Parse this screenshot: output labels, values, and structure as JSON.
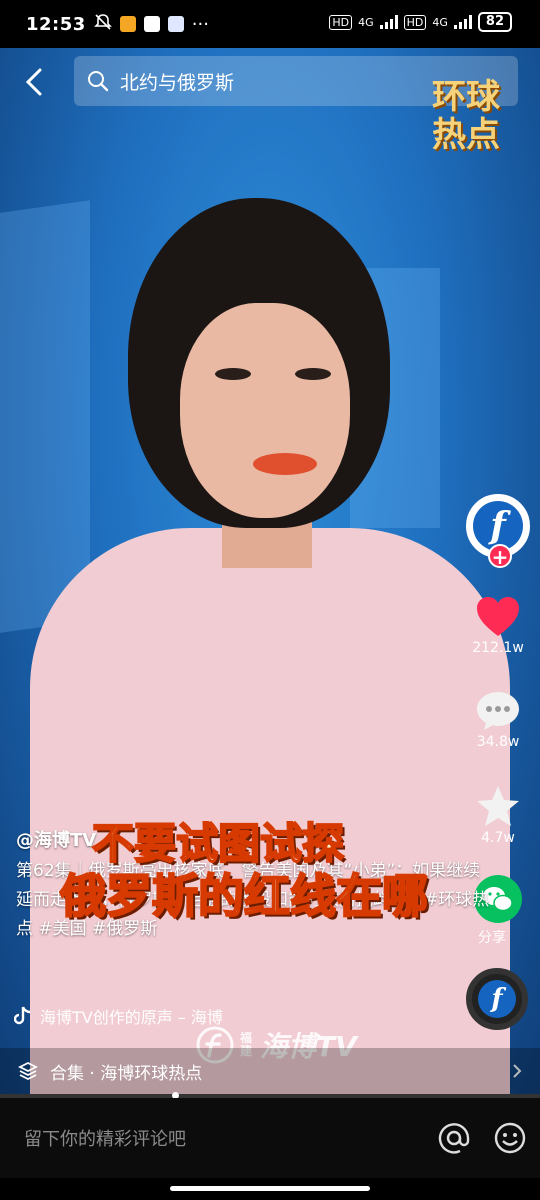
{
  "status_bar": {
    "time": "12:53",
    "network_1": "4G",
    "network_2": "4G",
    "hd": "HD",
    "battery": "82",
    "more": "···"
  },
  "search": {
    "query": "北约与俄罗斯"
  },
  "brand_badge": {
    "line1": "环球",
    "line2": "热点"
  },
  "actions": {
    "likes": "212.1w",
    "comments": "34.8w",
    "favorites": "4.7w",
    "share_label": "分享"
  },
  "post": {
    "author": "@海博TV",
    "caption": "第62集｜俄罗斯亮出核家底，警告美国及其“小弟”：如果继续延而走险时，俄罗斯有足够的手段和能力收拾挑衅者！#环球热点 #美国 #俄罗斯",
    "overlay_line1": "不要试图试探",
    "overlay_line2": "俄罗斯的红线在哪"
  },
  "music": {
    "label": "海博TV创作的原声 – 海博"
  },
  "watermark": {
    "sub": "福建",
    "name": "海博TV"
  },
  "collection": {
    "label": "合集 · 海博环球热点"
  },
  "comment_bar": {
    "placeholder": "留下你的精彩评论吧"
  },
  "colors": {
    "like": "#fe2c55",
    "wechat": "#07c160",
    "brand_blue": "#1565c0"
  }
}
